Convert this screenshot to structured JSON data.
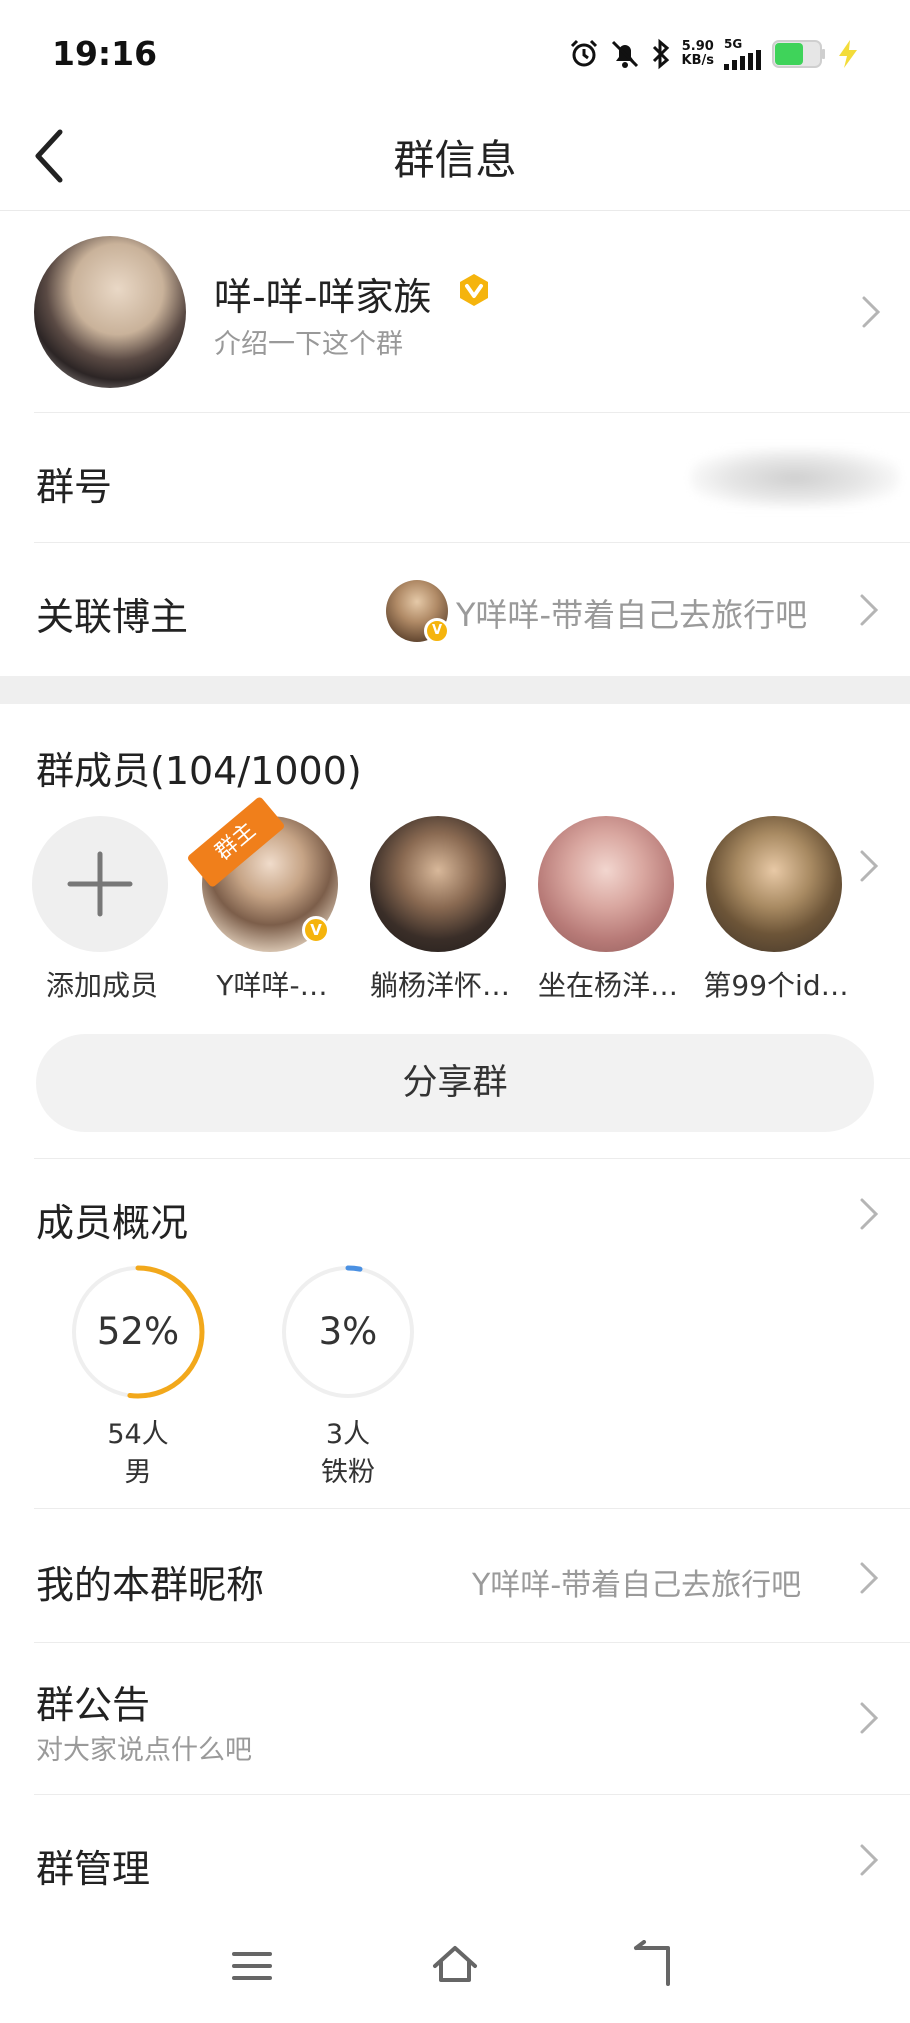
{
  "status": {
    "time": "19:16",
    "net_speed_value": "5.90",
    "net_speed_unit": "KB/s",
    "network": "5G"
  },
  "header": {
    "title": "群信息"
  },
  "group": {
    "name": "咩-咩-咩家族",
    "description": "介绍一下这个群"
  },
  "rows": {
    "group_number_label": "群号",
    "linked_blogger_label": "关联博主",
    "linked_blogger_value": "Y咩咩-带着自己去旅行吧"
  },
  "members": {
    "title": "群成员(104/1000)",
    "owner_tag": "群主",
    "items": [
      {
        "name": "添加成员"
      },
      {
        "name": "Y咩咩-…"
      },
      {
        "name": "躺杨洋怀…"
      },
      {
        "name": "坐在杨洋…"
      },
      {
        "name": "第99个id…"
      }
    ],
    "share_label": "分享群"
  },
  "overview": {
    "title": "成员概况",
    "stats": [
      {
        "percent_label": "52%",
        "fraction": 0.52,
        "count": "54人",
        "category": "男",
        "color": "#f2a81b"
      },
      {
        "percent_label": "3%",
        "fraction": 0.03,
        "count": "3人",
        "category": "铁粉",
        "color": "#4a90e2"
      }
    ]
  },
  "settings": {
    "nickname_label": "我的本群昵称",
    "nickname_value": "Y咩咩-带着自己去旅行吧",
    "notice_label": "群公告",
    "notice_sub": "对大家说点什么吧",
    "manage_label": "群管理"
  },
  "colors": {
    "accent_orange": "#f07f1b",
    "badge_gold": "#f5b40d",
    "battery_green": "#3fd35a"
  },
  "icons": [
    "back-arrow-icon",
    "chevron-right-icon",
    "plus-icon",
    "verified-badge-icon",
    "menu-icon",
    "home-icon",
    "return-icon"
  ]
}
